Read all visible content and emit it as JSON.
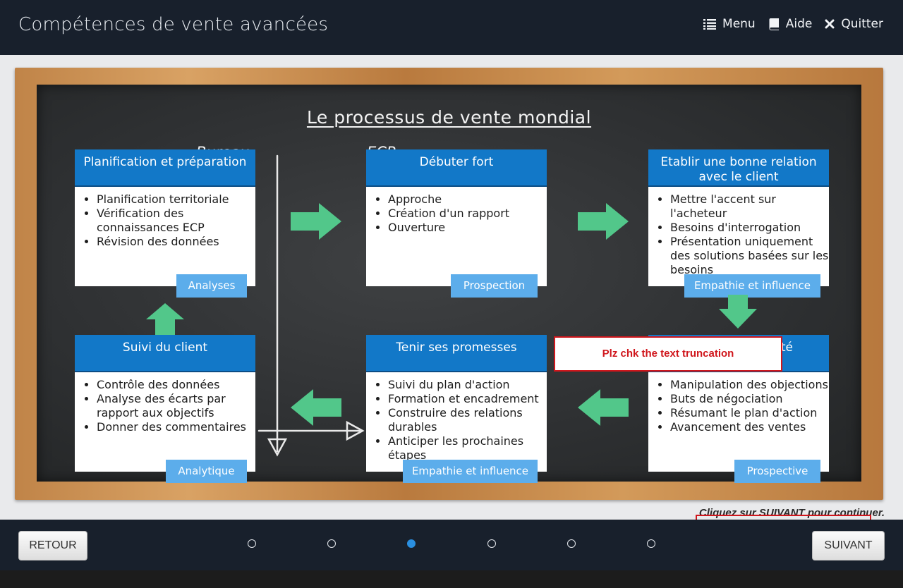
{
  "header": {
    "title": "Compétences de vente avancées",
    "nav": [
      {
        "label": "Menu",
        "icon": "list-icon"
      },
      {
        "label": "Aide",
        "icon": "book-icon"
      },
      {
        "label": "Quitter",
        "icon": "close-icon"
      }
    ]
  },
  "board": {
    "title": "Le processus de vente mondial",
    "col_labels": {
      "left": "Bureau",
      "right": "ECP"
    },
    "cards": [
      {
        "title": "Planification et préparation",
        "items": [
          "Planification territoriale",
          "Vérification des connaissances ECP",
          "Révision des données"
        ],
        "tag": "Analyses"
      },
      {
        "title": "Débuter fort",
        "items": [
          "Approche",
          "Création d'un rapport",
          "Ouverture"
        ],
        "tag": "Prospection"
      },
      {
        "title": "Etablir une bonne relation avec le client",
        "items": [
          "Mettre l'accent sur l'acheteur",
          "Besoins d'interrogation",
          "Présentation uniquement des solutions basées sur les besoins"
        ],
        "tag": "Empathie et influence"
      },
      {
        "title": "Suivi du client",
        "items": [
          "Contrôle des données",
          "Analyse des écarts par rapport aux objectifs",
          "Donner des commentaires"
        ],
        "tag": "Analytique"
      },
      {
        "title": "Tenir ses promesses",
        "items": [
          "Suivi du plan d'action",
          "Formation et encadrement",
          "Construire des relations durables",
          "Anticiper les prochaines étapes"
        ],
        "tag": "Empathie et influence"
      },
      {
        "title": "té",
        "items": [
          "Manipulation des objections",
          "Buts de négociation",
          "Résumant le plan d'action",
          "Avancement des ventes"
        ],
        "tag": "Prospective"
      }
    ],
    "note": "Plz chk the text truncation"
  },
  "footer": {
    "hint": "Cliquez sur SUIVANT pour continuer.",
    "back_label": "RETOUR",
    "next_label": "SUIVANT",
    "pages": 6,
    "current_page": 3
  },
  "colors": {
    "bar": "#18202c",
    "card_header": "#1278c8",
    "tag": "#5cadeb",
    "arrow": "#52c78a",
    "note_border": "#d0161c"
  }
}
